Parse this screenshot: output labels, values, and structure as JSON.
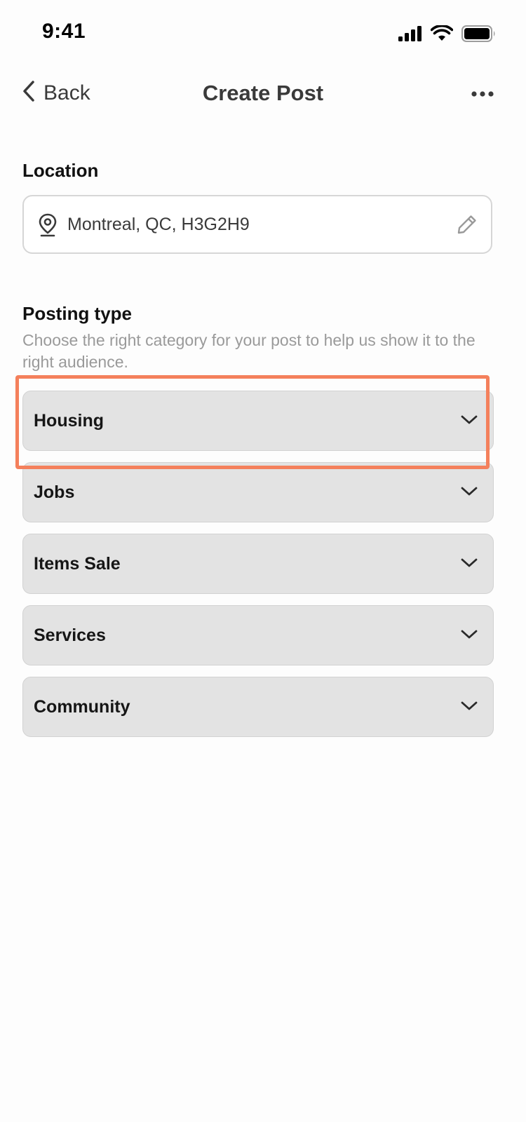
{
  "status_bar": {
    "time": "9:41"
  },
  "nav": {
    "back_label": "Back",
    "title": "Create Post"
  },
  "location": {
    "label": "Location",
    "value": "Montreal, QC, H3G2H9"
  },
  "posting_type": {
    "label": "Posting type",
    "helper": "Choose the right category for your post to help us show it to the right audience.",
    "categories": [
      {
        "label": "Housing",
        "highlighted": true
      },
      {
        "label": "Jobs",
        "highlighted": false
      },
      {
        "label": "Items Sale",
        "highlighted": false
      },
      {
        "label": "Services",
        "highlighted": false
      },
      {
        "label": "Community",
        "highlighted": false
      }
    ]
  },
  "icons": {
    "signal": "cellular-signal-icon",
    "wifi": "wifi-icon",
    "battery": "battery-icon",
    "back": "chevron-left-icon",
    "more": "more-horizontal-icon",
    "pin": "map-pin-icon",
    "edit": "pencil-icon",
    "expand": "chevron-down-icon"
  },
  "colors": {
    "highlight": "#f4805c",
    "category_bg": "#e3e3e3",
    "helper_text": "#9a9a9a"
  }
}
